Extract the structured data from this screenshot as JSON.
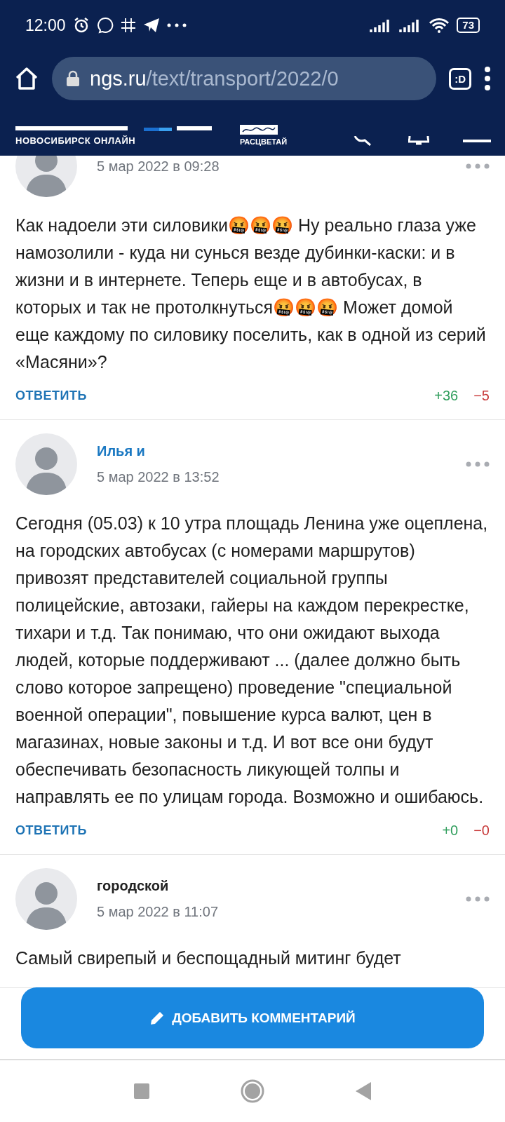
{
  "status_bar": {
    "time": "12:00",
    "battery": "73"
  },
  "browser": {
    "url_host": "ngs.ru",
    "url_path": "/text/transport/2022/0",
    "tab_count": ":D"
  },
  "site_header": {
    "tagline": "НОВОСИБИРСК ОНЛАЙН",
    "promo": "РАСЦВЕТАЙ"
  },
  "comments": [
    {
      "date": "5 мар 2022 в 09:28",
      "body": "Как надоели эти силовики🤬🤬🤬 Ну реально глаза уже намозолили - куда ни сунься везде дубинки-каски: и в жизни и в интернете. Теперь еще и в автобусах, в которых и так не протолкнуться🤬🤬🤬 Может домой еще каждому по силовику поселить, как в одной из серий «Масяни»?",
      "reply": "ОТВЕТИТЬ",
      "likes": "+36",
      "dislikes": "−5"
    },
    {
      "author": "Илья и",
      "date": "5 мар 2022 в 13:52",
      "body": "Сегодня (05.03) к 10 утра площадь Ленина уже оцеплена, на городских автобусах (с номерами маршрутов) привозят представителей социальной группы полицейские, автозаки, гайеры на каждом перекрестке, тихари и т.д. Так понимаю, что они ожидают выхода людей, которые поддерживают ... (далее должно быть слово которое запрещено) проведение \"специальной военной операции\", повышение курса валют, цен в магазинах, новые законы и т.д. И вот все они будут обеспечивать безопасность ликующей толпы и направлять ее по улицам города. Возможно и ошибаюсь.",
      "reply": "ОТВЕТИТЬ",
      "likes": "+0",
      "dislikes": "−0"
    },
    {
      "author": "городской",
      "date": "5 мар 2022 в 11:07",
      "body": "Самый свирепый и беспощадный митинг будет"
    }
  ],
  "add_comment_button": "ДОБАВИТЬ КОММЕНТАРИЙ"
}
